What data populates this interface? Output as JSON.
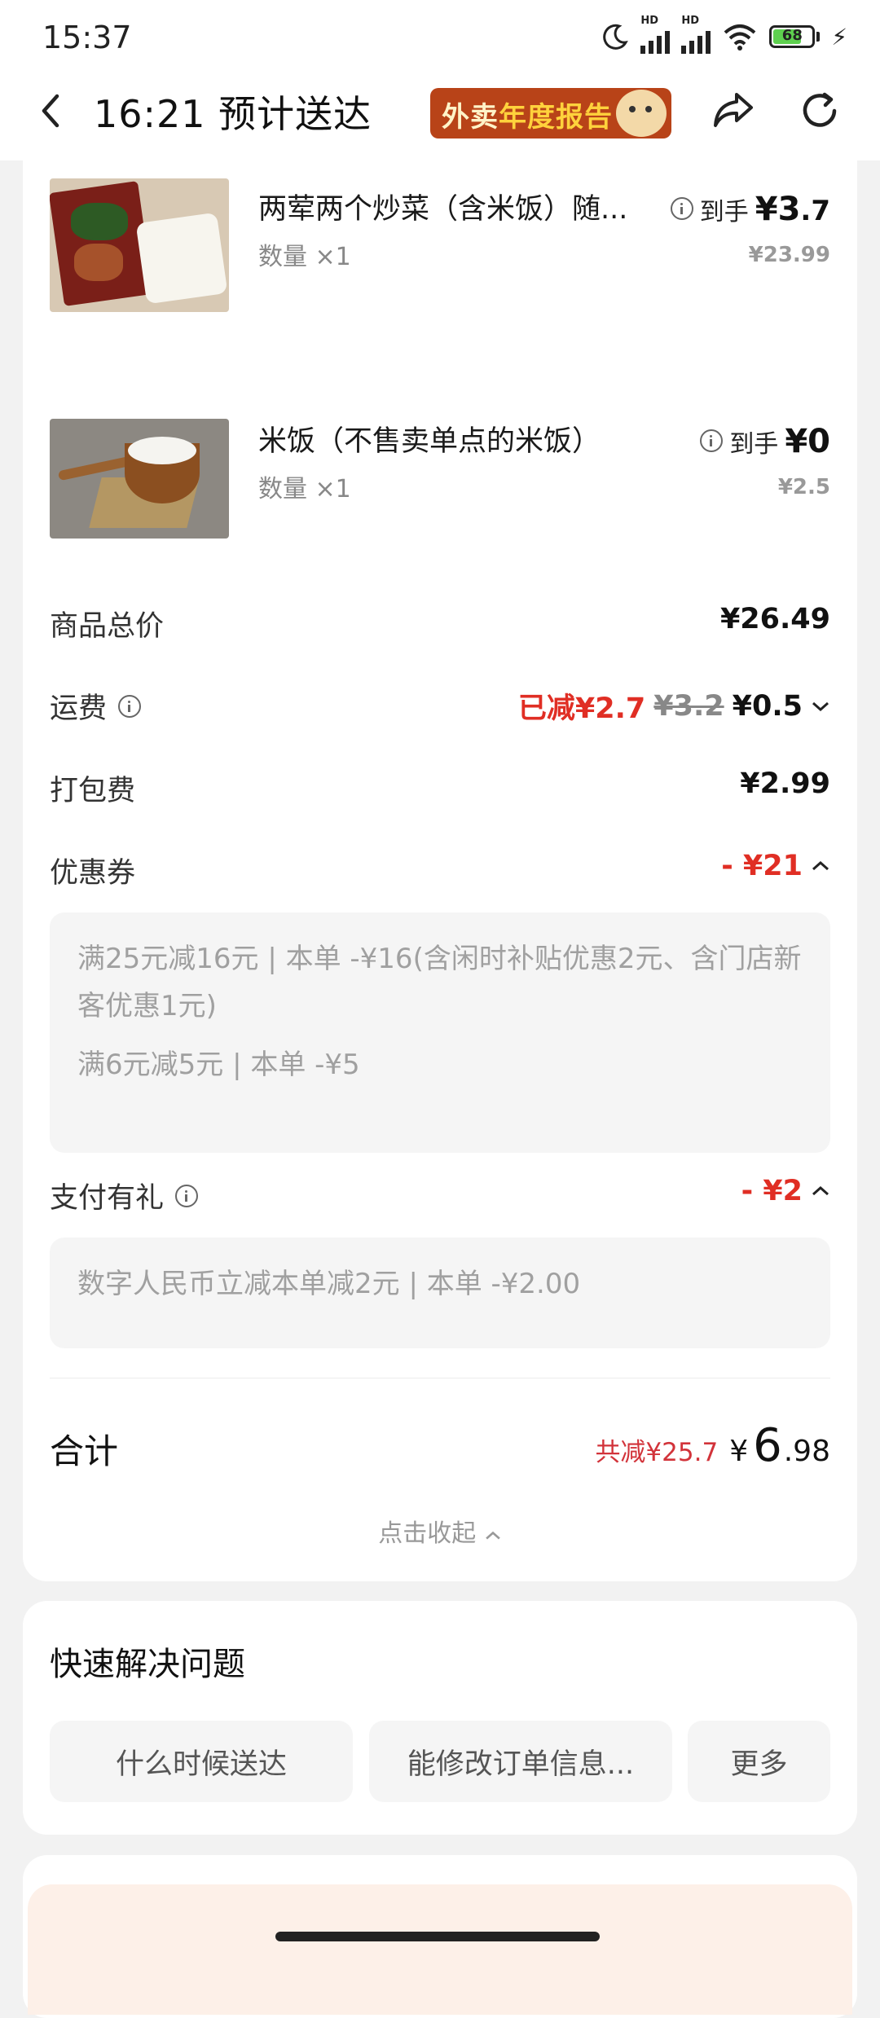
{
  "status_bar": {
    "time": "15:37",
    "battery": "68",
    "signal_tag": "HD"
  },
  "header": {
    "title": "16:21 预计送达",
    "banner_prefix": "外卖",
    "banner_highlight": "年度报告"
  },
  "items": [
    {
      "name": "两荤两个炒菜（含米饭）随...",
      "qty": "数量 ×1",
      "price_prefix": "到手",
      "price_currency": "¥",
      "price_int": "3",
      "price_dec": ".7",
      "original_price": "¥23.99"
    },
    {
      "name": "米饭（不售卖单点的米饭）",
      "qty": "数量 ×1",
      "price_prefix": "到手",
      "price_currency": "¥",
      "price_int": "0",
      "price_dec": "",
      "original_price": "¥2.5"
    }
  ],
  "summary": {
    "goods_label": "商品总价",
    "goods_value": "¥26.49",
    "delivery_label": "运费",
    "delivery_reduced": "已减¥2.7",
    "delivery_original": "¥3.2",
    "delivery_value": "¥0.5",
    "packing_label": "打包费",
    "packing_value": "¥2.99",
    "coupon_label": "优惠券",
    "coupon_value": "- ¥21",
    "coupon_details": [
      "满25元减16元 | 本单 -¥16(含闲时补贴优惠2元、含门店新客优惠1元)",
      "满6元减5元 | 本单 -¥5"
    ],
    "pay_gift_label": "支付有礼",
    "pay_gift_value": "- ¥2",
    "pay_gift_detail": "数字人民币立减本单减2元 | 本单 -¥2.00",
    "total_label": "合计",
    "total_saved": "共减¥25.7",
    "total_currency": "¥",
    "total_int": "6",
    "total_dec": ".98",
    "collapse": "点击收起"
  },
  "quick_help": {
    "title": "快速解决问题",
    "buttons": [
      "什么时候送达",
      "能修改订单信息...",
      "更多"
    ]
  },
  "colors": {
    "accent_red": "#e02e24",
    "muted_text": "#999999",
    "card_bg": "#ffffff",
    "page_bg": "#f2f2f2"
  }
}
